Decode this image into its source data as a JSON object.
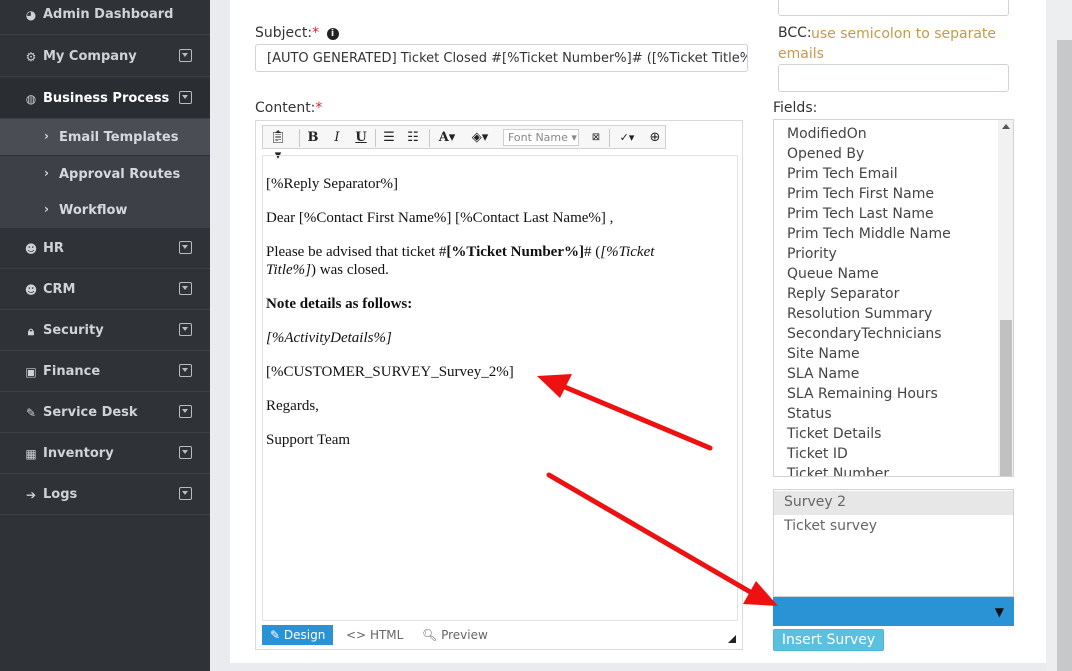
{
  "sidebar": {
    "items": [
      {
        "label": "Admin Dashboard",
        "icon": "dashboard-icon"
      },
      {
        "label": "My Company",
        "icon": "gear-icon"
      },
      {
        "label": "Business Process",
        "icon": "globe-icon"
      },
      {
        "label": "HR",
        "icon": "users-icon"
      },
      {
        "label": "CRM",
        "icon": "users-icon"
      },
      {
        "label": "Security",
        "icon": "lock-icon"
      },
      {
        "label": "Finance",
        "icon": "money-icon"
      },
      {
        "label": "Service Desk",
        "icon": "wrench-icon"
      },
      {
        "label": "Inventory",
        "icon": "building-icon"
      },
      {
        "label": "Logs",
        "icon": "sign-in-icon"
      }
    ],
    "sub_items": [
      {
        "label": "Email Templates"
      },
      {
        "label": "Approval Routes"
      },
      {
        "label": "Workflow"
      }
    ]
  },
  "form": {
    "subject_label": "Subject:",
    "required_mark": "*",
    "info_glyph": "i",
    "subject_value": "[AUTO GENERATED] Ticket Closed #[%Ticket Number%]# ([%Ticket Title%])",
    "content_label": "Content:",
    "bcc_label": "BCC:",
    "bcc_hint_line1": "use semicolon to separate",
    "bcc_hint_line2": "emails",
    "fields_label": "Fields:"
  },
  "editor": {
    "font_name_placeholder": "Font Name",
    "toolbar": {
      "bold": "B",
      "italic": "I",
      "underline": "U",
      "font_color": "A"
    },
    "content": {
      "p1": "[%Reply Separator%]",
      "p2": "Dear [%Contact First Name%] [%Contact Last Name%] ,",
      "p3_prefix": "Please be advised that ticket #",
      "p3_bold": "[%Ticket Number%]",
      "p3_mid": "#  (",
      "p3_italic1": "[%Ticket",
      "p3_italic2": "Title%]",
      "p3_suffix": ") was closed.",
      "p4": "Note details as follows:",
      "p5": "[%ActivityDetails%]",
      "p6": "[%CUSTOMER_SURVEY_Survey_2%]",
      "p7": "Regards,",
      "p8": "Support Team"
    },
    "modes": {
      "design": "Design",
      "html": "HTML",
      "preview": "Preview"
    }
  },
  "fields": {
    "items": [
      "ModifiedOn",
      "Opened By",
      "Prim Tech Email",
      "Prim Tech First Name",
      "Prim Tech Last Name",
      "Prim Tech Middle Name",
      "Priority",
      "Queue Name",
      "Reply Separator",
      "Resolution Summary",
      "SecondaryTechnicians",
      "Site Name",
      "SLA Name",
      "SLA Remaining Hours",
      "Status",
      "Ticket Details",
      "Ticket ID",
      "Ticket Number"
    ]
  },
  "survey": {
    "options": [
      "Survey 2",
      "Ticket survey"
    ],
    "selected": "Survey 2",
    "insert_label": "Insert Survey"
  },
  "colors": {
    "sidebar_bg": "#2f3237",
    "accent_blue": "#2a93d5",
    "insert_button": "#5bc0de",
    "annotation_arrow": "#ee1111",
    "hint_text": "#c49a4a"
  }
}
